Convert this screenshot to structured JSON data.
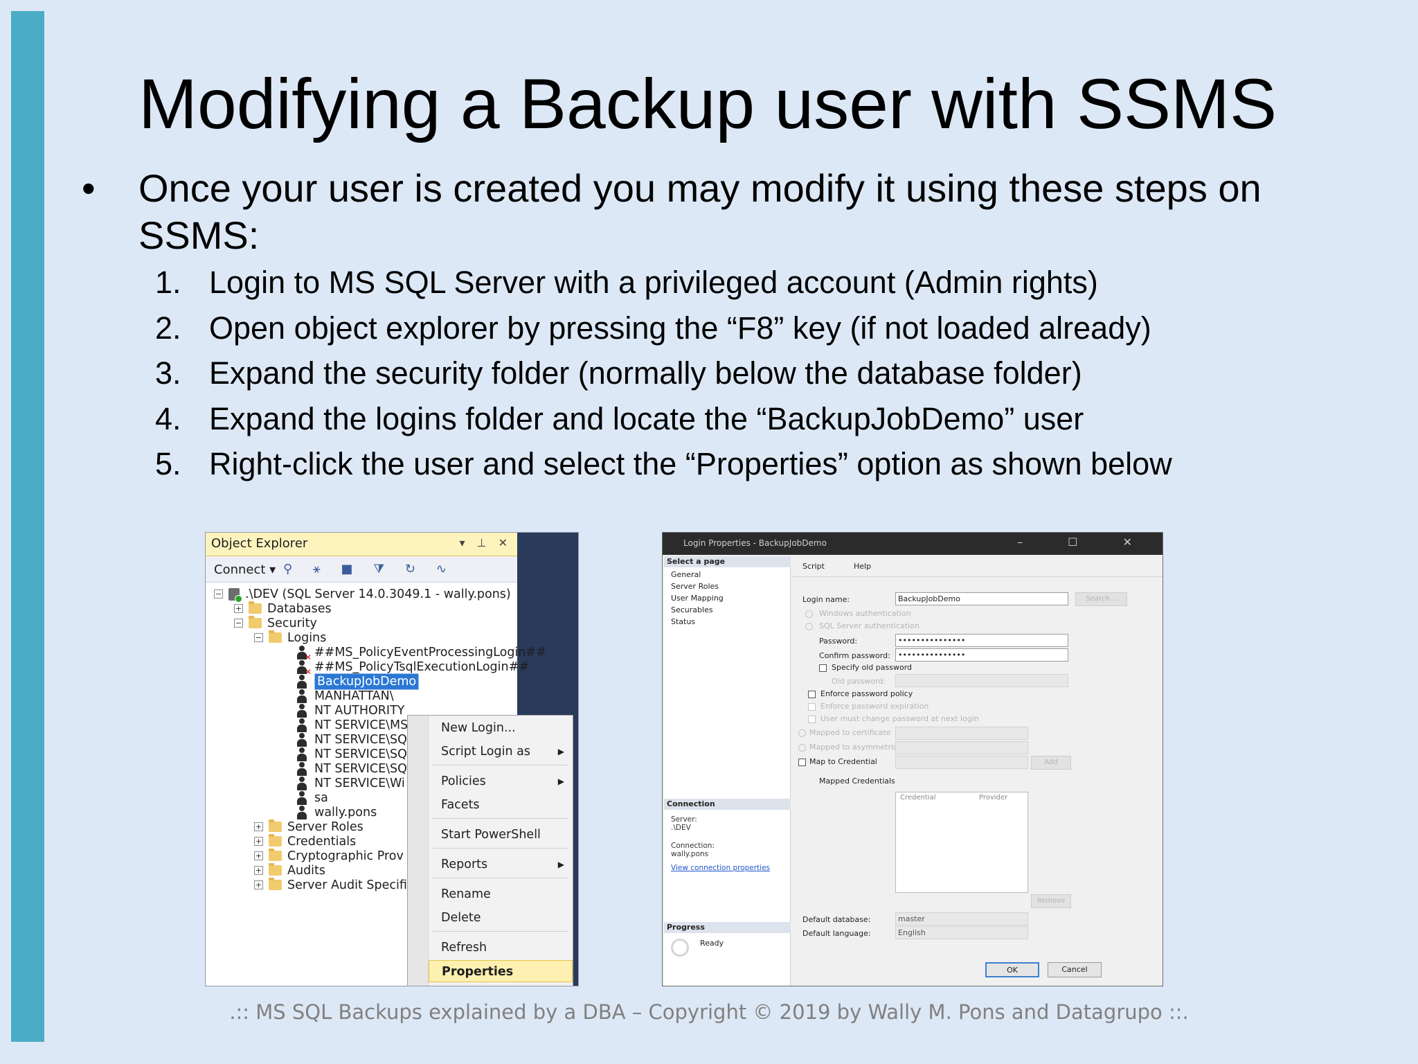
{
  "slide": {
    "title": "Modifying a Backup user with SSMS",
    "bullet_marker": "•",
    "bullet": "Once your user is created you may modify it using these steps on SSMS:",
    "steps": [
      {
        "num": "1.",
        "text": "Login to MS SQL Server with a privileged account (Admin rights)"
      },
      {
        "num": "2.",
        "text": "Open object explorer by pressing the “F8” key (if not loaded already)"
      },
      {
        "num": "3.",
        "text": "Expand the security folder (normally below the database folder)"
      },
      {
        "num": "4.",
        "text": "Expand the logins folder and locate the “BackupJobDemo” user"
      },
      {
        "num": "5.",
        "text": "Right-click the user and select the “Properties” option as shown below"
      }
    ],
    "footer": ".:: MS SQL Backups explained by a DBA – Copyright © 2019 by Wally M. Pons and Datagrupo ::.",
    "accent_color": "#4bacc6",
    "background_color": "#dde8f6"
  },
  "object_explorer": {
    "title": "Object Explorer",
    "header_icons": "▾ ⊥ ✕",
    "connect_label": "Connect ▾",
    "toolbar_icons": "⚲ ⚹ ■ ⧩ ↻ ∿",
    "server": ".\\DEV (SQL Server 14.0.3049.1 - wally.pons)",
    "databases": "Databases",
    "security": "Security",
    "logins": "Logins",
    "login_items": [
      "##MS_PolicyEventProcessingLogin##",
      "##MS_PolicyTsqlExecutionLogin##",
      "BackupJobDemo",
      "MANHATTAN\\",
      "NT AUTHORITY",
      "NT SERVICE\\MS",
      "NT SERVICE\\SQ",
      "NT SERVICE\\SQ",
      "NT SERVICE\\SQ",
      "NT SERVICE\\Wi",
      "sa",
      "wally.pons"
    ],
    "folders": [
      "Server Roles",
      "Credentials",
      "Cryptographic Prov",
      "Audits",
      "Server Audit Specifi"
    ],
    "toggle_expanded": "−",
    "toggle_collapsed": "+",
    "disabled_mark": "✕"
  },
  "context_menu": {
    "items": [
      {
        "label": "New Login...",
        "arrow": ""
      },
      {
        "label": "Script Login as",
        "arrow": "▶"
      },
      {
        "label": "Policies",
        "arrow": "▶"
      },
      {
        "label": "Facets",
        "arrow": ""
      },
      {
        "label": "Start PowerShell",
        "arrow": ""
      },
      {
        "label": "Reports",
        "arrow": "▶"
      },
      {
        "label": "Rename",
        "arrow": ""
      },
      {
        "label": "Delete",
        "arrow": ""
      },
      {
        "label": "Refresh",
        "arrow": ""
      },
      {
        "label": "Properties",
        "arrow": ""
      }
    ]
  },
  "login_properties": {
    "window_title": "Login Properties - BackupJobDemo",
    "window_buttons": "– ☐ ✕",
    "select_page": "Select a page",
    "pages": [
      "General",
      "Server Roles",
      "User Mapping",
      "Securables",
      "Status"
    ],
    "connection_header": "Connection",
    "server_label": "Server:",
    "server_value": ".\\DEV",
    "connection_label": "Connection:",
    "connection_value": "wally.pons",
    "view_connection": "View connection properties",
    "progress_header": "Progress",
    "progress_status": "Ready",
    "script_label": "Script",
    "help_label": "Help",
    "login_name_label": "Login name:",
    "login_name_value": "BackupJobDemo",
    "search_button": "Search...",
    "windows_auth": "Windows authentication",
    "sql_auth": "SQL Server authentication",
    "password_label": "Password:",
    "password_value": "•••••••••••••••",
    "confirm_label": "Confirm password:",
    "confirm_value": "•••••••••••••••",
    "specify_old": "Specify old password",
    "old_password": "Old password:",
    "enforce_policy": "Enforce password policy",
    "enforce_expiration": "Enforce password expiration",
    "must_change": "User must change password at next login",
    "mapped_cert": "Mapped to certificate",
    "mapped_key": "Mapped to asymmetric key",
    "map_credential": "Map to Credential",
    "add_button": "Add",
    "mapped_credentials": "Mapped Credentials",
    "grid_credential": "Credential",
    "grid_provider": "Provider",
    "remove_button": "Remove",
    "default_db_label": "Default database:",
    "default_db_value": "master",
    "default_lang_label": "Default language:",
    "default_lang_value": "English",
    "ok_button": "OK",
    "cancel_button": "Cancel"
  }
}
